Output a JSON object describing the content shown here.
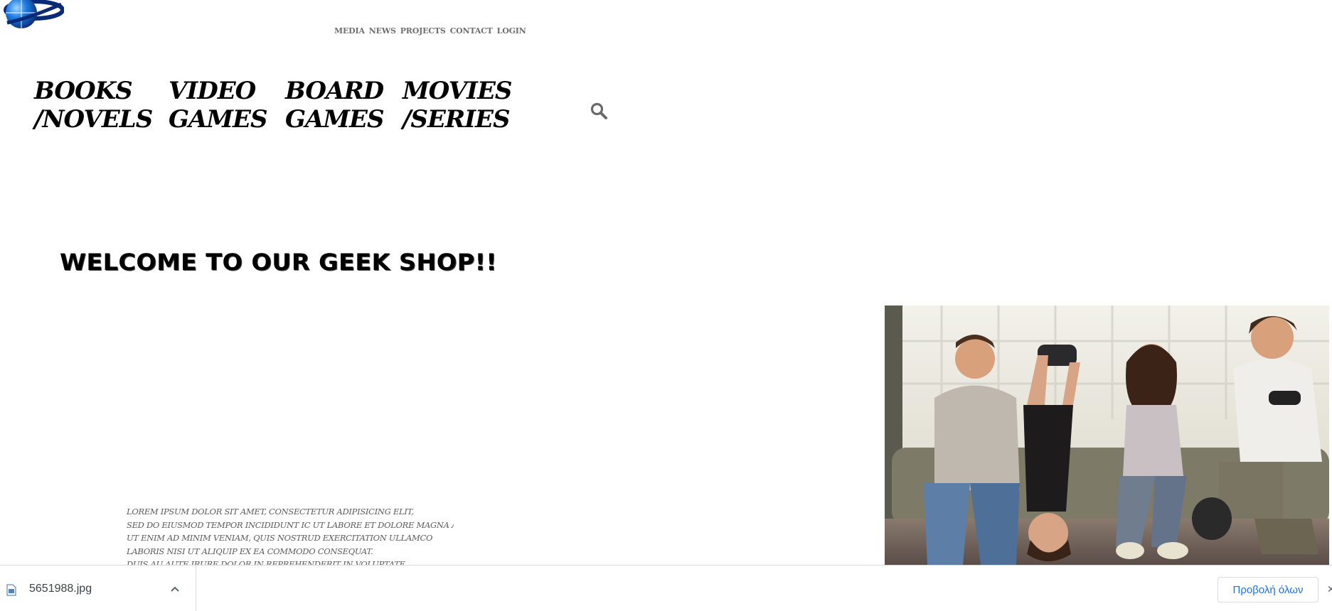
{
  "top_nav": [
    "MEDIA",
    "NEWS",
    "PROJECTS",
    "CONTACT",
    "LOGIN"
  ],
  "categories": [
    {
      "line1": "BOOKS",
      "line2": "/NOVELS"
    },
    {
      "line1": "VIDEO",
      "line2": "GAMES"
    },
    {
      "line1": "BOARD",
      "line2": "GAMES"
    },
    {
      "line1": "MOVIES",
      "line2": "/SERIES"
    }
  ],
  "icons": {
    "search": "search-icon",
    "logo": "globe-logo",
    "file": "image-file-icon",
    "chevron": "chevron-up-icon",
    "close": "close-icon"
  },
  "welcome": "WELCOME TO OUR GEEK SHOP!!",
  "lorem_lines": [
    "LOREM IPSUM DOLOR SIT AMET, CONSECTETUR ADIPISICING ELIT,",
    "SED DO EIUSMOD TEMPOR INCIDIDUNT IC UT LABORE ET DOLORE MAGNA ALIQUA.",
    "UT ENIM AD MINIM VENIAM, QUIS NOSTRUD EXERCITATION ULLAMCO",
    "LABORIS NISI UT ALIQUIP EX EA COMMODO CONSEQUAT.",
    "DUIS AU AUTE IRURE DOLOR IN REPREHENDERIT IN VOLUPTATE"
  ],
  "download_bar": {
    "filename": "5651988.jpg",
    "show_all": "Προβολή όλων"
  },
  "colors": {
    "nav_text": "#6f6f6f",
    "accent_blue": "#1a73e8"
  }
}
